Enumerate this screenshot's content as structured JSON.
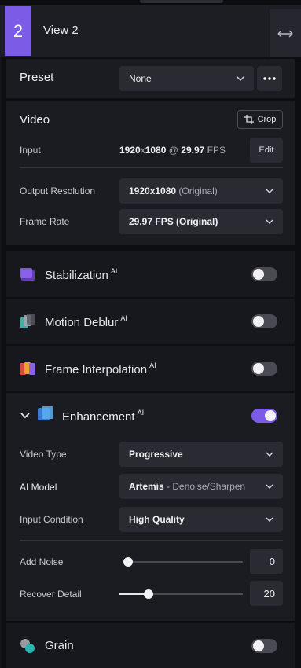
{
  "header": {
    "view_number": "2",
    "view_title": "View 2",
    "expand_icon": "horizontal-arrows-icon"
  },
  "preset": {
    "label": "Preset",
    "value": "None",
    "more_label": "•••"
  },
  "video": {
    "title": "Video",
    "crop_label": "Crop",
    "input_label": "Input",
    "input_resolution": "1920",
    "input_x": "x",
    "input_resolution_h": "1080",
    "input_at": "@",
    "input_fps": "29.97",
    "input_fps_unit": "FPS",
    "edit_label": "Edit",
    "output_resolution_label": "Output Resolution",
    "output_resolution_value": "1920x1080",
    "output_resolution_note": "(Original)",
    "frame_rate_label": "Frame Rate",
    "frame_rate_value": "29.97 FPS (Original)"
  },
  "features": {
    "stabilization": {
      "label": "Stabilization",
      "badge": "AI",
      "enabled": false
    },
    "motion_deblur": {
      "label": "Motion Deblur",
      "badge": "AI",
      "enabled": false
    },
    "frame_interpolation": {
      "label": "Frame Interpolation",
      "badge": "AI",
      "enabled": false
    },
    "enhancement": {
      "label": "Enhancement",
      "badge": "AI",
      "enabled": true
    },
    "grain": {
      "label": "Grain",
      "enabled": false
    }
  },
  "enhancement": {
    "video_type_label": "Video Type",
    "video_type_value": "Progressive",
    "ai_model_label": "AI Model",
    "ai_model_name": "Artemis",
    "ai_model_sep": "-",
    "ai_model_variant": "Denoise/Sharpen",
    "input_condition_label": "Input Condition",
    "input_condition_value": "High Quality",
    "add_noise_label": "Add Noise",
    "add_noise_value": "0",
    "add_noise_fraction": 0,
    "recover_detail_label": "Recover Detail",
    "recover_detail_value": "20",
    "recover_detail_fraction": 0.2
  },
  "colors": {
    "accent": "#7c5ce6",
    "panel": "#1b1c22",
    "toggle_off": "#4a4b52"
  }
}
